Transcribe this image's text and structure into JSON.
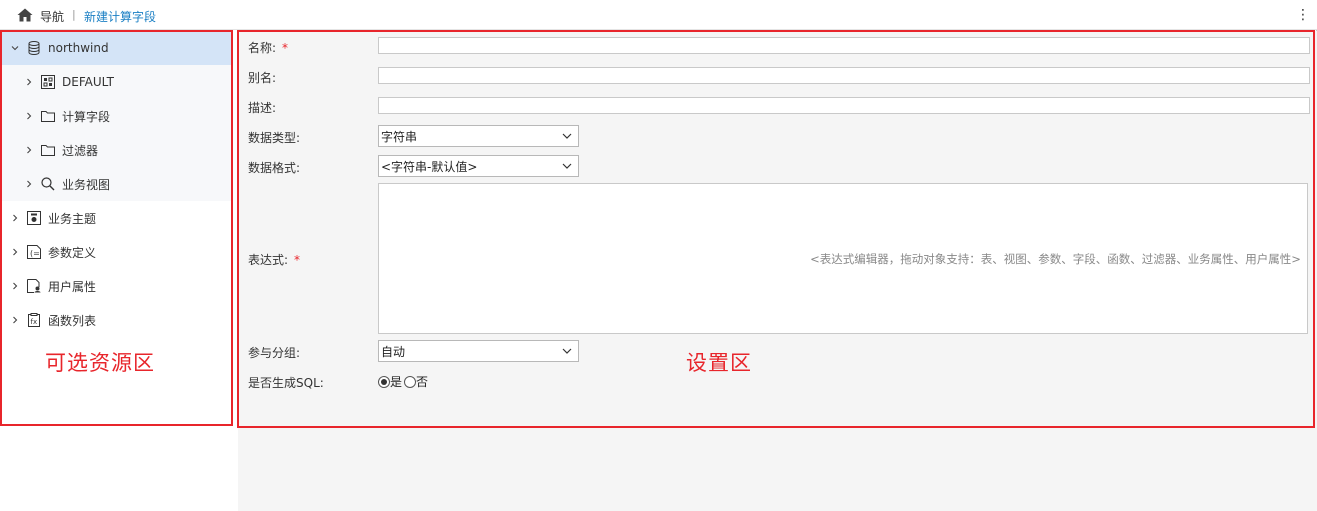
{
  "topbar": {
    "nav_label": "导航",
    "separator": "|",
    "current_page": "新建计算字段",
    "more_icon": "⋮"
  },
  "tree": {
    "items": [
      {
        "label": "northwind",
        "icon": "database-icon",
        "expanded": true,
        "selected": true
      },
      {
        "label": "DEFAULT",
        "icon": "schema-icon"
      },
      {
        "label": "计算字段",
        "icon": "folder-icon"
      },
      {
        "label": "过滤器",
        "icon": "folder-icon"
      },
      {
        "label": "业务视图",
        "icon": "search-icon"
      },
      {
        "label": "业务主题",
        "icon": "business-theme-icon"
      },
      {
        "label": "参数定义",
        "icon": "parameter-icon"
      },
      {
        "label": "用户属性",
        "icon": "user-attribute-icon"
      },
      {
        "label": "函数列表",
        "icon": "function-list-icon"
      }
    ],
    "zone_label": "可选资源区"
  },
  "form": {
    "name_label": "名称:",
    "alias_label": "别名:",
    "description_label": "描述:",
    "data_type_label": "数据类型:",
    "data_type_value": "字符串",
    "data_format_label": "数据格式:",
    "data_format_value": "<字符串-默认值>",
    "expression_label": "表达式:",
    "expression_placeholder": "<表达式编辑器，拖动对象支持：表、视图、参数、字段、函数、过滤器、业务属性、用户属性>",
    "group_label": "参与分组:",
    "group_value": "自动",
    "sql_label": "是否生成SQL:",
    "sql_yes": "是",
    "sql_no": "否",
    "sql_selected": "是",
    "required_mark": "*",
    "zone_label": "设置区"
  },
  "colors": {
    "accent_link": "#1a7fc4",
    "highlight_red": "#e8252b",
    "selected_bg": "#d4e4f7"
  }
}
